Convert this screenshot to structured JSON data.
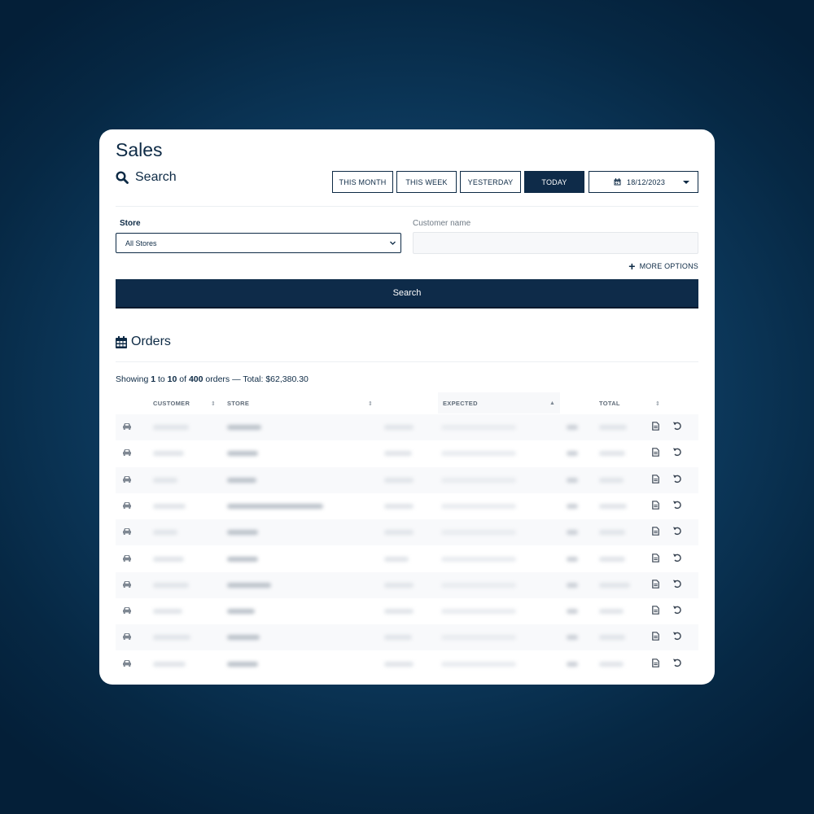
{
  "page": {
    "title": "Sales",
    "search_heading": "Search"
  },
  "periods": [
    {
      "label": "THIS MONTH",
      "active": false
    },
    {
      "label": "THIS WEEK",
      "active": false
    },
    {
      "label": "YESTERDAY",
      "active": false
    },
    {
      "label": "TODAY",
      "active": true
    }
  ],
  "date_picker": {
    "value": "18/12/2023"
  },
  "filters": {
    "store_label": "Store",
    "store_value": "All Stores",
    "customer_label": "Customer name",
    "customer_value": "",
    "more_options_label": "MORE OPTIONS"
  },
  "search_button": {
    "label": "Search"
  },
  "orders": {
    "heading": "Orders",
    "showing_prefix": "Showing",
    "from": "1",
    "to_word": "to",
    "to": "10",
    "of_word": "of",
    "total_count": "400",
    "orders_word": "orders — Total:",
    "total_amount": "$62,380.30",
    "columns": [
      "CUSTOMER",
      "STORE",
      "EXPECTED",
      "TOTAL"
    ],
    "row_count": 10
  },
  "colors": {
    "primary": "#0e2b49",
    "background": "#0b3557",
    "input_bg": "#f7f8fa"
  },
  "icons": {
    "search": "search-icon",
    "calendar": "calendar-icon",
    "plus": "plus-icon",
    "orders": "calendar-grid-icon",
    "row_type": "car-icon",
    "row_doc": "document-icon",
    "row_undo": "undo-icon"
  }
}
